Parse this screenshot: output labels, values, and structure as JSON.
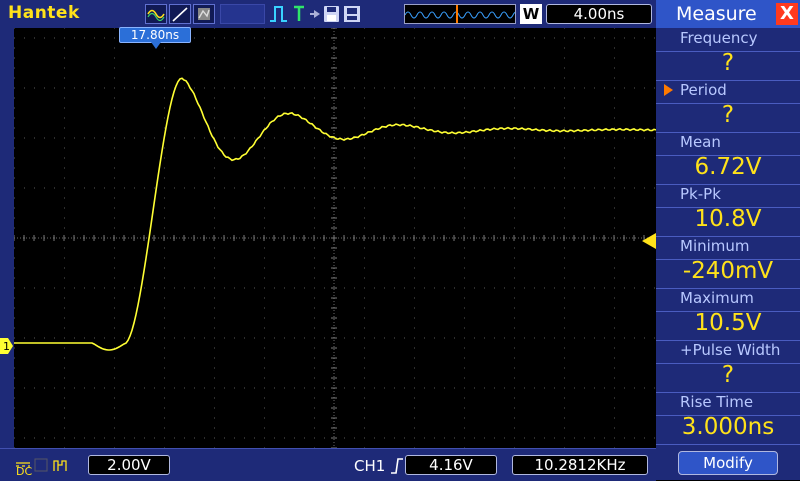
{
  "topbar": {
    "logo": "Hantek",
    "w_badge": "W",
    "timebase": "4.00ns"
  },
  "trigger_marker": {
    "time": "17.80ns"
  },
  "channel": {
    "marker": "1",
    "coupling": "DC"
  },
  "bottom": {
    "volts_div": "2.00V",
    "trigger_source": "CH1",
    "trigger_level": "4.16V",
    "frequency": "10.2812KHz"
  },
  "panel": {
    "title": "Measure",
    "close_label": "X",
    "modify_label": "Modify",
    "measurements": [
      {
        "label": "Frequency",
        "value": "?"
      },
      {
        "label": "Period",
        "value": "?"
      },
      {
        "label": "Mean",
        "value": "6.72V"
      },
      {
        "label": "Pk-Pk",
        "value": "10.8V"
      },
      {
        "label": "Minimum",
        "value": "-240mV"
      },
      {
        "label": "Maximum",
        "value": "10.5V"
      },
      {
        "label": "+Pulse Width",
        "value": "?"
      },
      {
        "label": "Rise Time",
        "value": "3.000ns"
      }
    ]
  },
  "colors": {
    "trace": "#ffff33",
    "panel_bg": "#1e2a78",
    "accent_yellow": "#ffe21a",
    "close_red": "#ff3a1f"
  }
}
